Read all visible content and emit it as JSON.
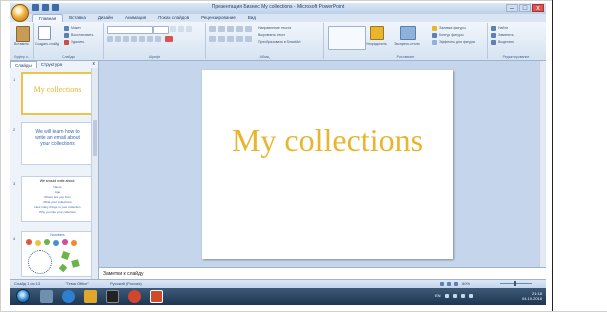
{
  "window": {
    "title": "Презентация Бизнес My collections - Microsoft PowerPoint",
    "minimize": "–",
    "maximize": "□",
    "close": "x"
  },
  "ribbon_tabs": [
    "Главная",
    "Вставка",
    "Дизайн",
    "Анимация",
    "Показ слайдов",
    "Рецензирование",
    "Вид"
  ],
  "ribbon": {
    "clipboard": {
      "label": "Буфер о...",
      "paste": "Вставить",
      "create_slide": "Создать слайд"
    },
    "slides": {
      "label": "Слайды",
      "layout": "Макет",
      "reset": "Восстановить",
      "delete": "Удалить"
    },
    "font": {
      "label": "Шрифт"
    },
    "paragraph": {
      "label": "Абзац",
      "text_direction": "Направление текста",
      "align_text": "Выровнять текст",
      "smartart": "Преобразовать в SmartArt"
    },
    "drawing": {
      "label": "Рисование",
      "arrange": "Упорядочить",
      "quick_styles": "Экспресс-стили",
      "fill": "Заливка фигуры",
      "outline": "Контур фигуры",
      "effects": "Эффекты для фигуры"
    },
    "editing": {
      "label": "Редактирование",
      "find": "Найти",
      "replace": "Заменить",
      "select": "Выделить"
    }
  },
  "left_pane": {
    "tabs": [
      "Слайды",
      "Структура"
    ],
    "close": "x",
    "slides": [
      {
        "num": "1",
        "title": "My collections"
      },
      {
        "num": "2",
        "title": "We will learn how to write an email about your collections"
      },
      {
        "num": "3",
        "title": "We should write about:",
        "lines": [
          "Name",
          "Age",
          "Where are you from",
          "What your collections",
          "How many things in your collection",
          "Why you like your collection"
        ]
      },
      {
        "num": "4",
        "title": "Numbers"
      }
    ]
  },
  "slide": {
    "title": "My collections"
  },
  "notes": {
    "placeholder": "Заметки к слайду"
  },
  "status": {
    "slide_of": "Слайд 1 из 13",
    "theme": "\"Тема Office\"",
    "language": "Русский (Россия)",
    "zoom": "60%"
  },
  "taskbar": {
    "lang": "EN",
    "time": "21:18",
    "date": "04.10.2018"
  },
  "colors": {
    "title_yellow": "#e8b52d",
    "thumb_blue": "#3b64a8"
  }
}
